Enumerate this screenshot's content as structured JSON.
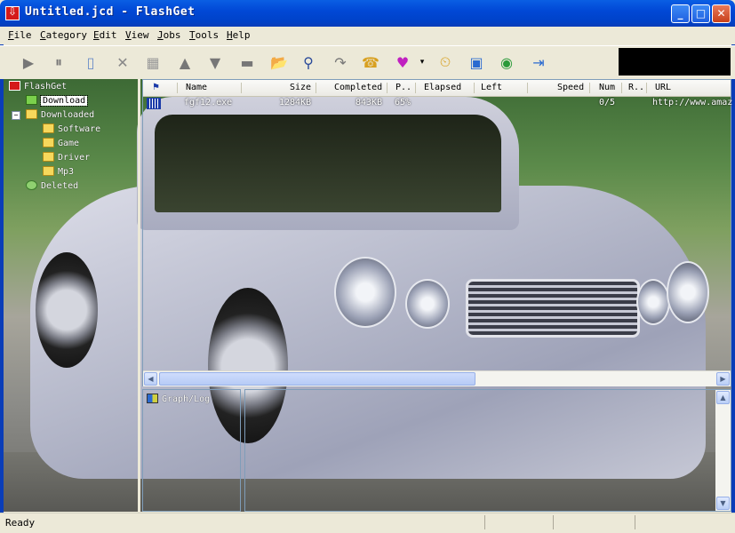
{
  "window": {
    "title": "Untitled.jcd - FlashGet",
    "minimize": "_",
    "maximize": "□",
    "close": "✕"
  },
  "menu": [
    "File",
    "Category",
    "Edit",
    "View",
    "Jobs",
    "Tools",
    "Help"
  ],
  "toolbar": {
    "icons": [
      "play-icon",
      "pause-icon",
      "new-icon",
      "delete-icon",
      "properties-icon",
      "move-up-icon",
      "move-down-icon",
      "sort-icon",
      "open-folder-icon",
      "find-icon",
      "find-next-icon",
      "dial-icon",
      "speed-icon",
      "dropdown-icon",
      "schedule-icon",
      "monitor-icon",
      "site-explorer-icon",
      "export-icon"
    ]
  },
  "tree": {
    "root": "FlashGet",
    "download": "Download",
    "downloaded": "Downloaded",
    "software": "Software",
    "game": "Game",
    "driver": "Driver",
    "mp3": "Mp3",
    "deleted": "Deleted"
  },
  "list": {
    "columns": [
      "Name",
      "Size",
      "Completed",
      "P..",
      "Elapsed",
      "Left",
      "Speed",
      "Num",
      "R..",
      "URL"
    ],
    "rows": [
      {
        "name": "fgf12.exe",
        "size": "1284KB",
        "completed": "843KB",
        "percent": "65%",
        "elapsed": "",
        "left": "",
        "speed": "",
        "num": "0/5",
        "retry": "",
        "url": "http://www.amaz"
      }
    ]
  },
  "graph_log_label": "Graph/Log",
  "status": {
    "text": "Ready"
  }
}
